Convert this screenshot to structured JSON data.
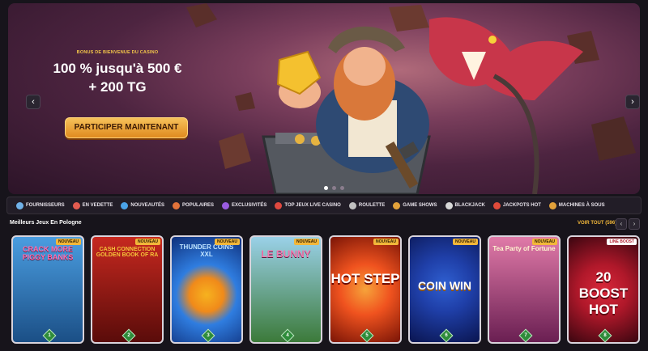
{
  "hero": {
    "eyebrow": "BONUS DE BIENVENUE DU CASINO",
    "line1": "100 % jusqu'à 500 €",
    "line2": "+ 200 TG",
    "cta_label": "PARTICIPER MAINTENANT",
    "prev_icon": "‹",
    "next_icon": "›"
  },
  "categories": [
    {
      "label": "FOURNISSEURS",
      "icon": "providers-icon",
      "color": "#6fb1e8"
    },
    {
      "label": "EN VEDETTE",
      "icon": "featured-icon",
      "color": "#e25b4f"
    },
    {
      "label": "NOUVEAUTÉS",
      "icon": "new-icon",
      "color": "#4aa3e8"
    },
    {
      "label": "POPULAIRES",
      "icon": "popular-icon",
      "color": "#e2733a"
    },
    {
      "label": "EXCLUSIVITÉS",
      "icon": "exclusive-icon",
      "color": "#9a5ce0"
    },
    {
      "label": "TOP JEUX LIVE CASINO",
      "icon": "live-casino-icon",
      "color": "#e0493f"
    },
    {
      "label": "ROULETTE",
      "icon": "roulette-icon",
      "color": "#c0c0c0"
    },
    {
      "label": "GAME SHOWS",
      "icon": "game-shows-icon",
      "color": "#e2a13a"
    },
    {
      "label": "BLACKJACK",
      "icon": "blackjack-icon",
      "color": "#d7d7d7"
    },
    {
      "label": "JACKPOTS HOT",
      "icon": "jackpot-icon",
      "color": "#e04a3a"
    },
    {
      "label": "MACHINES À SOUS",
      "icon": "slots-icon",
      "color": "#e2a13a"
    }
  ],
  "section": {
    "title": "Meilleurs Jeux En Pologne",
    "view_all": "VOIR TOUT (596)",
    "prev_icon": "‹",
    "next_icon": "›"
  },
  "games": [
    {
      "title": "CRACK MORE PIGGY BANKS",
      "rank": "1",
      "badge": "NOUVEAU",
      "bg1": "#4a9de0",
      "bg2": "#1b4f86"
    },
    {
      "title": "CASH CONNECTION GOLDEN BOOK OF RA",
      "rank": "2",
      "badge": "NOUVEAU",
      "bg1": "#c6281f",
      "bg2": "#5a0c0a"
    },
    {
      "title": "THUNDER COINS XXL",
      "rank": "3",
      "badge": "NOUVEAU",
      "bg1": "#2f7de0",
      "bg2": "#0f2f7a"
    },
    {
      "title": "LE BUNNY",
      "rank": "4",
      "badge": "NOUVEAU",
      "bg1": "#9ad1e8",
      "bg2": "#3c7a3a"
    },
    {
      "title": "HOT STEP",
      "rank": "5",
      "badge": "NOUVEAU",
      "bg1": "#f0531f",
      "bg2": "#7a1406"
    },
    {
      "title": "COIN WIN",
      "rank": "6",
      "badge": "NOUVEAU",
      "bg1": "#1f3fa8",
      "bg2": "#0a1550"
    },
    {
      "title": "Tea Party of Fortune",
      "rank": "7",
      "badge": "NOUVEAU",
      "bg1": "#e07aa8",
      "bg2": "#6a1f52"
    },
    {
      "title": "20 BOOST HOT",
      "rank": "8",
      "badge": "LINE BOOST",
      "bg1": "#b0182a",
      "bg2": "#3a0610"
    }
  ]
}
